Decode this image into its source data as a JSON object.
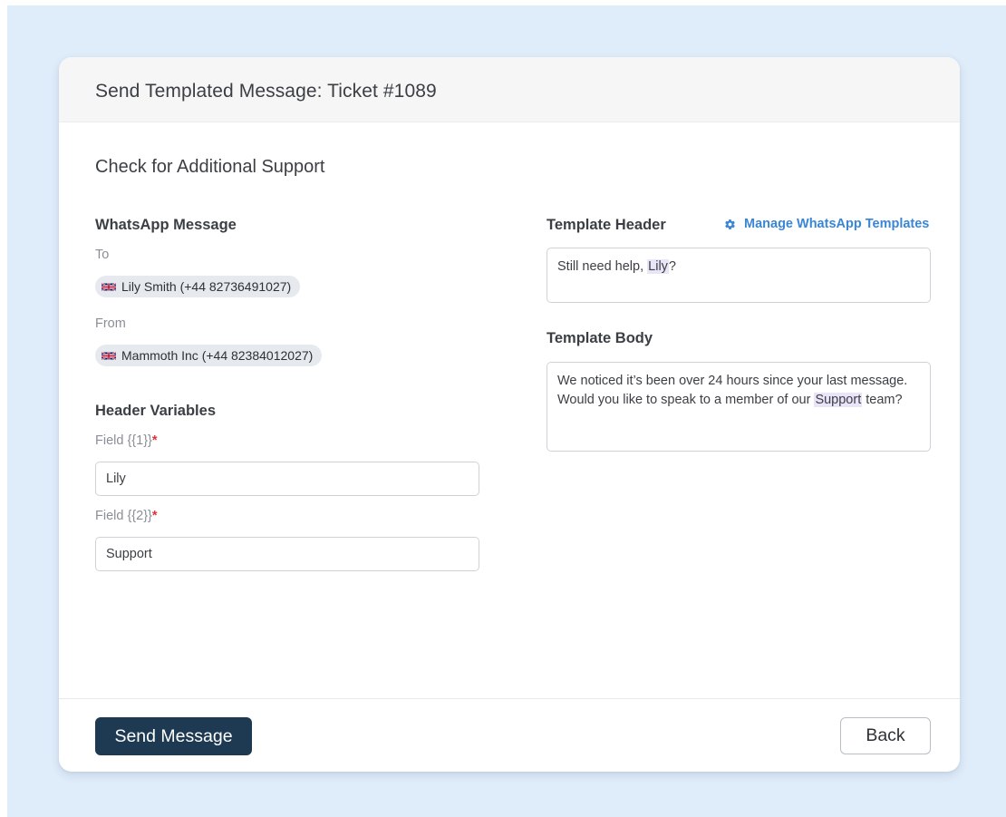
{
  "modal": {
    "title": "Send Templated Message: Ticket #1089",
    "section_title": "Check for Additional Support"
  },
  "whatsapp": {
    "heading": "WhatsApp Message",
    "to_label": "To",
    "to_value": "Lily Smith (+44 82736491027)",
    "from_label": "From",
    "from_value": "Mammoth Inc (+44 82384012027)",
    "flag_icon": "uk-flag-icon"
  },
  "header_variables": {
    "heading": "Header Variables",
    "fields": [
      {
        "label": "Field {{1}}",
        "required_mark": "*",
        "value": "Lily"
      },
      {
        "label": "Field {{2}}",
        "required_mark": "*",
        "value": "Support"
      }
    ]
  },
  "template": {
    "header_label": "Template Header",
    "manage_link": "Manage WhatsApp Templates",
    "manage_icon": "gear-icon",
    "header_text_before": "Still need help, ",
    "header_variable": "Lily",
    "header_text_after": "?",
    "body_label": "Template Body",
    "body_text_before": "We noticed it’s been over 24 hours since your last message. Would you like to speak to a member of our ",
    "body_variable": "Support",
    "body_text_after": " team?"
  },
  "footer": {
    "send_label": "Send Message",
    "back_label": "Back"
  },
  "colors": {
    "backdrop": "#dfecfa",
    "primary_button": "#1d3a52",
    "link": "#3a86d6",
    "variable_highlight": "#e9e4f7",
    "required": "#e0343a"
  }
}
